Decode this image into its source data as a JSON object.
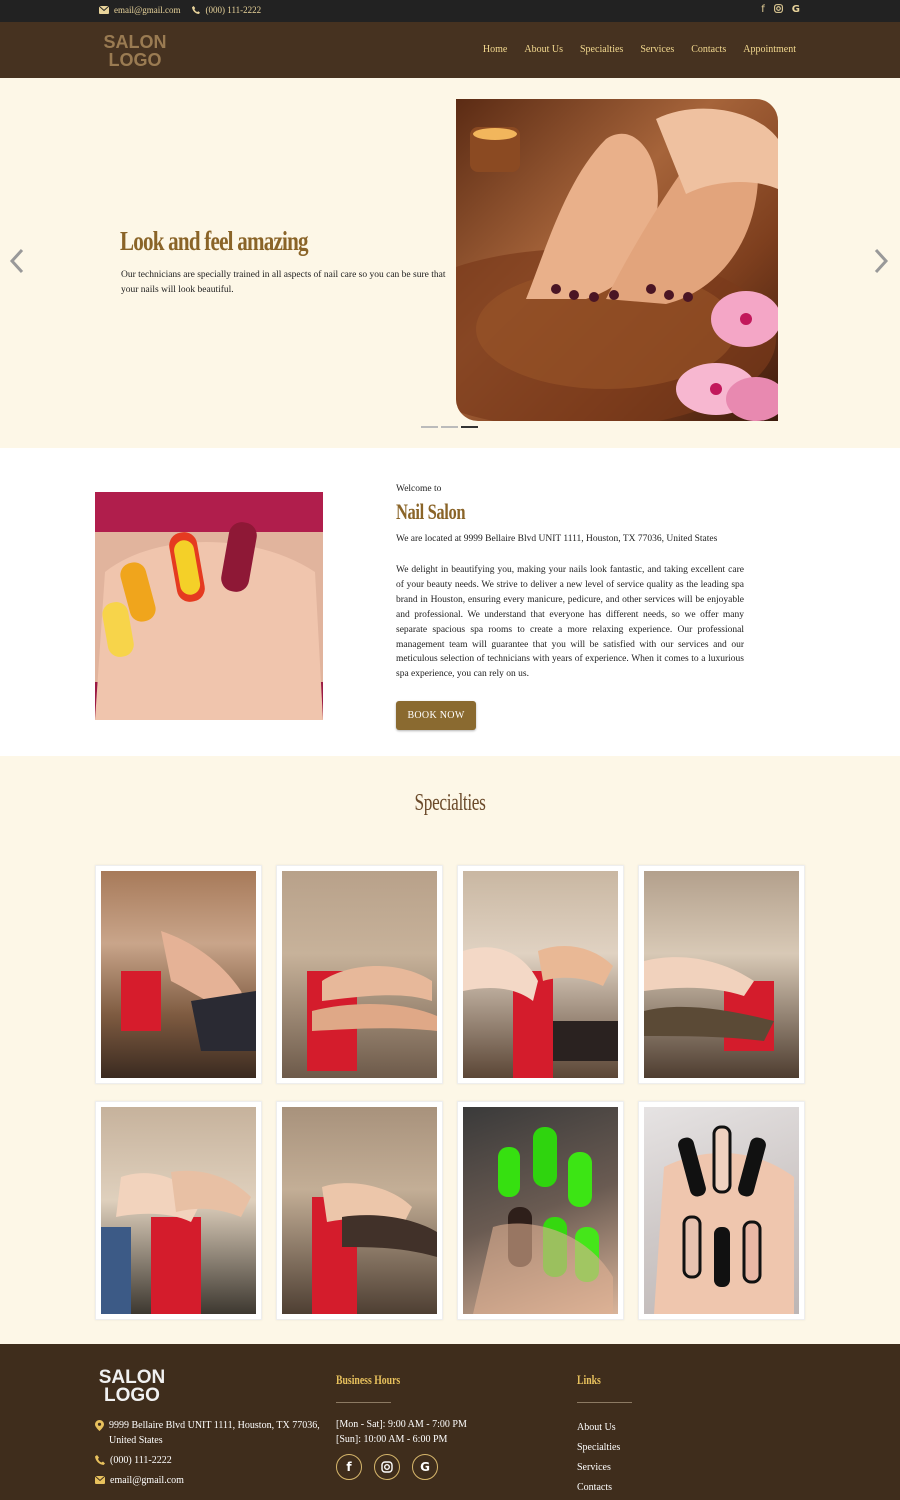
{
  "topbar": {
    "email": "email@gmail.com",
    "phone": "(000) 111-2222",
    "social_icons": [
      "facebook-icon",
      "instagram-icon",
      "google-icon"
    ]
  },
  "header": {
    "logo_line1": "SALON",
    "logo_line2": "LOGO",
    "nav": [
      "Home",
      "About Us",
      "Specialties",
      "Services",
      "Contacts",
      "Appointment"
    ]
  },
  "hero": {
    "title": "Look and feel amazing",
    "text": "Our technicians are specially trained in all aspects of nail care so you can be sure that your nails will look beautiful.",
    "slide_count": 3,
    "active_slide": 3
  },
  "about": {
    "welcome": "Welcome to",
    "title": "Nail Salon",
    "address": "We are located at 9999 Bellaire Blvd UNIT 1111, Houston, TX 77036, United States",
    "description": "We delight in beautifying you, making your nails look fantastic, and taking excellent care of your beauty needs. We strive to deliver a new level of service quality as the leading spa brand in Houston, ensuring every manicure, pedicure, and other services will be enjoyable and professional. We understand that everyone has different needs, so we offer many separate spacious spa rooms to create a more relaxing experience. Our professional management team will guarantee that you will be satisfied with our services and our meticulous selection of technicians with years of experience. When it comes to a luxurious spa experience, you can rely on us.",
    "button": "BOOK NOW"
  },
  "specialties": {
    "title": "Specialties"
  },
  "footer": {
    "logo_line1": "SALON",
    "logo_line2": "LOGO",
    "address": "9999 Bellaire Blvd UNIT 1111, Houston, TX 77036, United States",
    "phone": "(000) 111-2222",
    "email": "email@gmail.com",
    "hours_title": "Business Hours",
    "hours": [
      "[Mon - Sat]: 9:00 AM - 7:00 PM",
      "[Sun]: 10:00 AM - 6:00 PM"
    ],
    "links_title": "Links",
    "links": [
      "About Us",
      "Specialties",
      "Services",
      "Contacts"
    ]
  },
  "colors": {
    "accent_gold": "#8a6428",
    "header_brown": "#463220",
    "footer_brown": "#3f2d1c",
    "cream": "#fdf7e7"
  }
}
